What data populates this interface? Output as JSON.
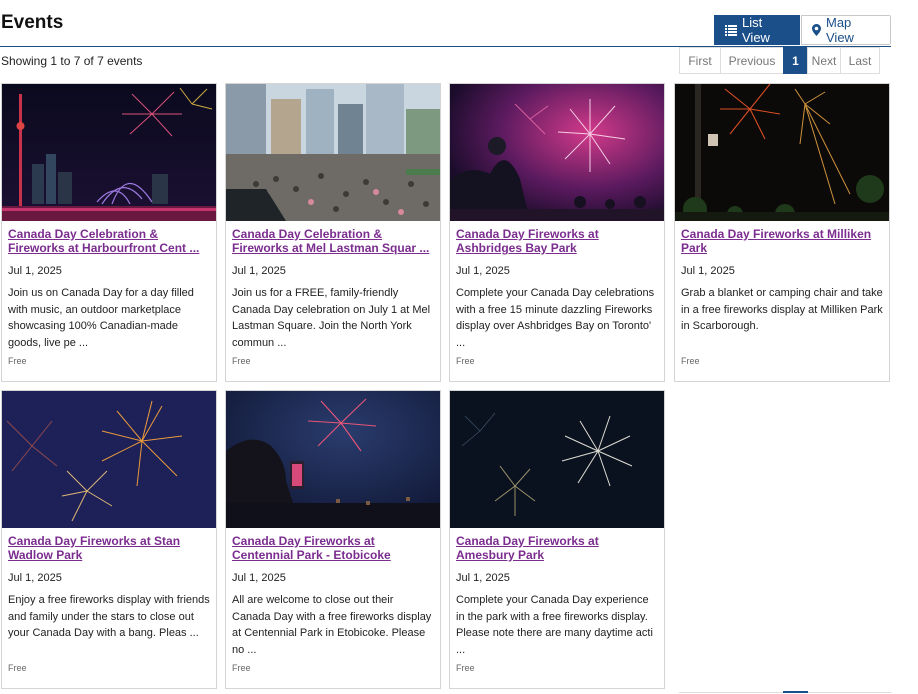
{
  "header": {
    "title": "Events"
  },
  "view_toggle": {
    "list_label": "List View",
    "map_label": "Map View"
  },
  "results": {
    "showing": "Showing 1 to 7 of 7 events"
  },
  "pager": {
    "first": "First",
    "previous": "Previous",
    "current": "1",
    "next": "Next",
    "last": "Last"
  },
  "colors": {
    "brand": "#1a4f8a",
    "link": "#7b2c8f"
  },
  "events": [
    {
      "title": "Canada Day Celebration & Fireworks at Harbourfront Cent ...",
      "date": "Jul 1, 2025",
      "description": "Join us on Canada Day for a day filled with music, an outdoor marketplace showcasing 100% Canadian-made goods, live pe ...",
      "price": "Free",
      "image": "harbourfront-fireworks-photo"
    },
    {
      "title": "Canada Day Celebration & Fireworks at Mel Lastman Squar ...",
      "date": "Jul 1, 2025",
      "description": "Join us for a FREE, family-friendly Canada Day celebration on July 1 at Mel Lastman Square. Join the North York commun ...",
      "price": "Free",
      "image": "mel-lastman-crowd-photo"
    },
    {
      "title": "Canada Day Fireworks at Ashbridges Bay Park",
      "date": "Jul 1, 2025",
      "description": "Complete your Canada Day celebrations with a free 15 minute dazzling Fireworks display over Ashbridges Bay on Toronto' ...",
      "price": "Free",
      "image": "ashbridges-fireworks-photo"
    },
    {
      "title": "Canada Day Fireworks at Milliken Park",
      "date": "Jul 1, 2025",
      "description": "Grab a blanket or camping chair and take in a free fireworks display at Milliken Park in Scarborough.",
      "price": "Free",
      "image": "milliken-fireworks-photo"
    },
    {
      "title": "Canada Day Fireworks at Stan Wadlow Park",
      "date": "Jul 1, 2025",
      "description": "Enjoy a free fireworks display with friends and family under the stars to close out your Canada Day with a bang. Pleas ...",
      "price": "Free",
      "image": "stan-wadlow-fireworks-photo"
    },
    {
      "title": "Canada Day Fireworks at Centennial Park - Etobicoke",
      "date": "Jul 1, 2025",
      "description": "All are welcome to close out their Canada Day with a free fireworks display at Centennial Park in Etobicoke. Please no ...",
      "price": "Free",
      "image": "centennial-fireworks-photo"
    },
    {
      "title": "Canada Day Fireworks at Amesbury Park",
      "date": "Jul 1, 2025",
      "description": "Complete your Canada Day experience in the park with a free fireworks display. Please note there are many daytime acti ...",
      "price": "Free",
      "image": "amesbury-fireworks-photo"
    }
  ]
}
